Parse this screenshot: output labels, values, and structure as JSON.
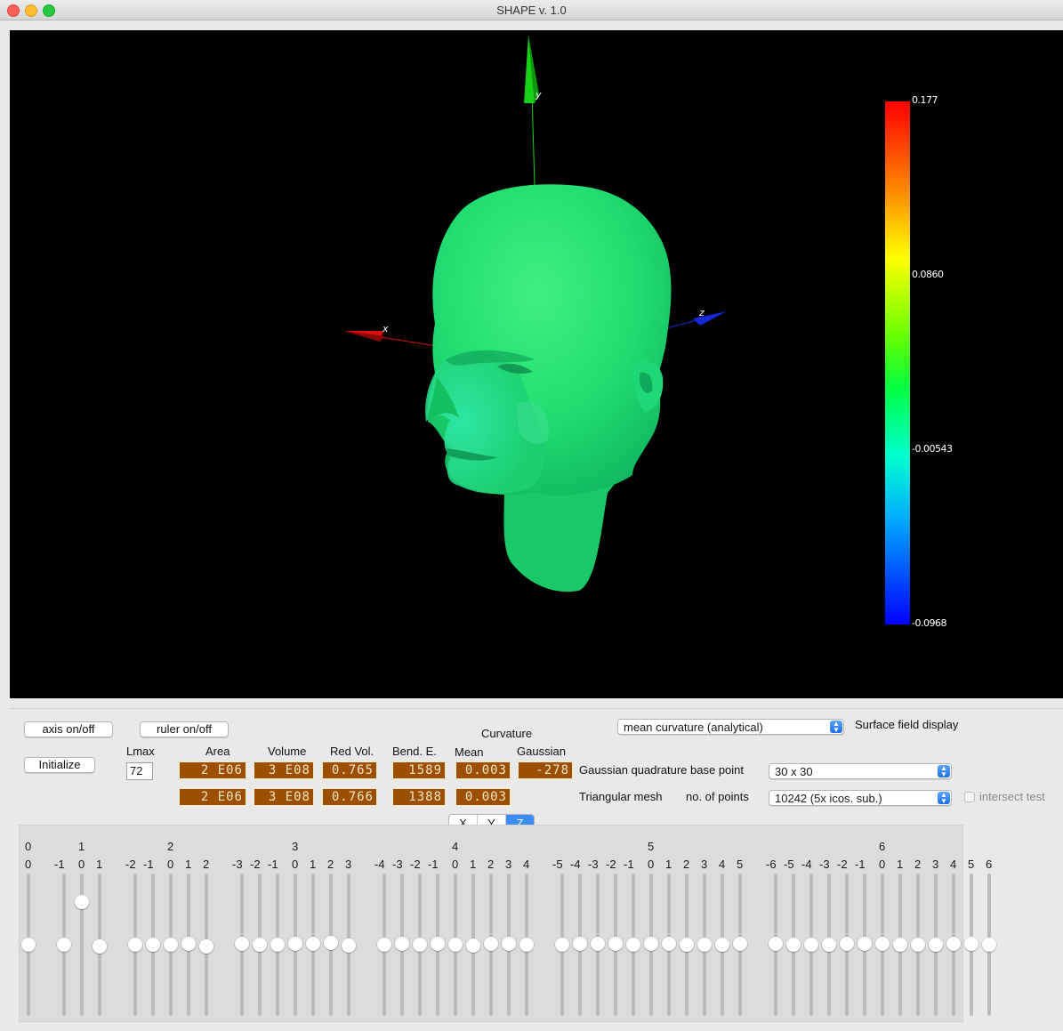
{
  "window": {
    "title": "SHAPE v. 1.0"
  },
  "viewport": {
    "axes": {
      "x": "x",
      "y": "y",
      "z": "z"
    },
    "colorbar": {
      "max": "0.177",
      "mid": "0.0860",
      "low": "-0.00543",
      "min": "-0.0968"
    },
    "colors": {
      "x_axis": "#d91010",
      "y_axis": "#18d018",
      "z_axis": "#1428d8",
      "surface": "#22e070"
    }
  },
  "controls": {
    "axis_button": "axis on/off",
    "ruler_button": "ruler on/off",
    "initialize_button": "Initialize",
    "lmax_label": "Lmax",
    "lmax_value": "72",
    "headers": {
      "area": "Area",
      "volume": "Volume",
      "red_vol": "Red Vol.",
      "bend_e": "Bend. E.",
      "curvature": "Curvature",
      "mean": "Mean",
      "gaussian": "Gaussian"
    },
    "row1": {
      "area": "2 E06",
      "volume": "3 E08",
      "red_vol": "0.765",
      "bend_e": "1589",
      "mean": "0.003",
      "gaussian": "-278"
    },
    "row2": {
      "area": "2 E06",
      "volume": "3 E08",
      "red_vol": "0.766",
      "bend_e": "1388",
      "mean": "0.003"
    },
    "surface_field_select": "mean curvature (analytical)",
    "surface_field_label": "Surface field display",
    "quadrature_label": "Gaussian quadrature base point",
    "quadrature_select": "30 x 30",
    "mesh_label": "Triangular mesh",
    "points_label": "no. of points",
    "points_select": "10242 (5x icos. sub.)",
    "intersect_label": "intersect test",
    "xyz": [
      "X",
      "Y",
      "Z"
    ],
    "active_axis": "Z"
  },
  "sliders": {
    "groups": [
      {
        "l": "0",
        "m": [
          "0"
        ],
        "values": [
          0
        ]
      },
      {
        "l": "1",
        "m": [
          "-1",
          "0",
          "1"
        ],
        "values": [
          0,
          1.0,
          -0.05
        ]
      },
      {
        "l": "2",
        "m": [
          "-2",
          "-1",
          "0",
          "1",
          "2"
        ],
        "values": [
          0,
          0,
          0,
          0.02,
          -0.05
        ]
      },
      {
        "l": "3",
        "m": [
          "-3",
          "-2",
          "-1",
          "0",
          "1",
          "2",
          "3"
        ],
        "values": [
          0.02,
          0,
          0,
          0.02,
          0.02,
          0.05,
          -0.02
        ]
      },
      {
        "l": "4",
        "m": [
          "-4",
          "-3",
          "-2",
          "-1",
          "0",
          "1",
          "2",
          "3",
          "4"
        ],
        "values": [
          0,
          0.02,
          0,
          0.02,
          0,
          -0.02,
          0.02,
          0.02,
          0
        ]
      },
      {
        "l": "5",
        "m": [
          "-5",
          "-4",
          "-3",
          "-2",
          "-1",
          "0",
          "1",
          "2",
          "3",
          "4",
          "5"
        ],
        "values": [
          0,
          0.02,
          0.02,
          0.02,
          0,
          0.02,
          0.02,
          0,
          0,
          0,
          0.02
        ]
      },
      {
        "l": "6",
        "m": [
          "-6",
          "-5",
          "-4",
          "-3",
          "-2",
          "-1",
          "0",
          "1",
          "2",
          "3",
          "4",
          "5",
          "6"
        ],
        "values": [
          0.02,
          0,
          0,
          0,
          0.02,
          0.02,
          0.02,
          0,
          0,
          0,
          0.02,
          0.02,
          0
        ]
      }
    ]
  }
}
